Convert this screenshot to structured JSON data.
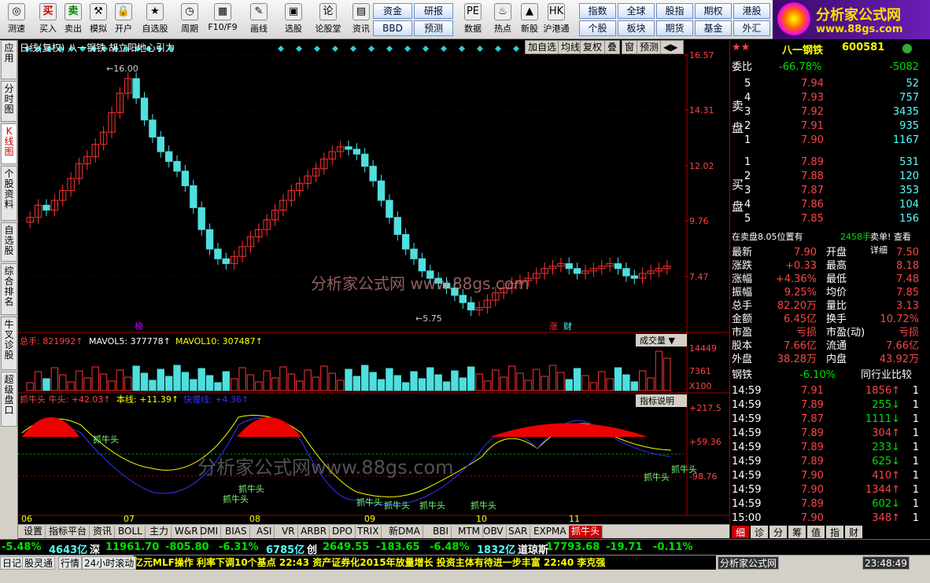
{
  "toolbar": {
    "buttons": [
      "测速",
      "买入",
      "卖出",
      "模拟",
      "开户",
      "自选股",
      "周期",
      "F10/F9",
      "画线",
      "选股",
      "论股堂",
      "资讯",
      "数据",
      "热点",
      "新股",
      "沪港通"
    ],
    "grid1": [
      "资金",
      "研报",
      "BBD",
      "预测"
    ],
    "grid2": [
      "指数",
      "全球",
      "股指",
      "期权",
      "港股",
      "个股",
      "板块",
      "期货",
      "基金",
      "外汇"
    ]
  },
  "logo": {
    "name": "分析家公式网",
    "url": "www.88gs.com"
  },
  "left_tabs": [
    "应用",
    "分时图",
    "K线图",
    "个股资料",
    "自选股",
    "综合排名",
    "牛叉诊股",
    "超级盘口"
  ],
  "chart": {
    "header": "日线(复权) 八一钢铁 胡立阳地心引力",
    "top_buttons": [
      "加自选",
      "均线",
      "复权",
      "叠",
      "窗",
      "预测"
    ],
    "price_ticks": [
      "16.57",
      "14.31",
      "12.02",
      "9.76",
      "7.47"
    ],
    "hi_label": "16.00",
    "lo_label": "5.75",
    "watermark1": "分析家公式网 www.88gs.com",
    "watermark2": "分析家公式网www.88gs.com",
    "markers": [
      "榜",
      "涨",
      "财"
    ],
    "vol_header": {
      "total": "总手: 821992↑",
      "ma5": "MAVOL5: 377778↑",
      "ma10": "MAVOL10: 307487↑",
      "dropdown": "成交量"
    },
    "vol_ticks": [
      "14449",
      "7361",
      "X100"
    ],
    "ind_header": {
      "a": "抓牛头 牛头: +42.03↑",
      "b": "本线: +11.39↑",
      "c": "快慢线: +4.36↑",
      "btn": "指标说明"
    },
    "ind_ticks": [
      "+217.5",
      "+59.36",
      "-98.76"
    ],
    "ind_label": "抓牛头",
    "months": [
      "06",
      "07",
      "08",
      "09",
      "10",
      "11"
    ]
  },
  "quote": {
    "name": "八一钢铁",
    "code": "600581",
    "webi": "委比",
    "webi_pct": "-66.78%",
    "webi_diff": "-5082",
    "sell": [
      [
        "5",
        "7.94",
        "52"
      ],
      [
        "4",
        "7.93",
        "757"
      ],
      [
        "3",
        "7.92",
        "3435"
      ],
      [
        "2",
        "7.91",
        "935"
      ],
      [
        "1",
        "7.90",
        "1167"
      ]
    ],
    "buy": [
      [
        "1",
        "7.89",
        "531"
      ],
      [
        "2",
        "7.88",
        "120"
      ],
      [
        "3",
        "7.87",
        "353"
      ],
      [
        "4",
        "7.86",
        "104"
      ],
      [
        "5",
        "7.85",
        "156"
      ]
    ],
    "sell_label": "卖盘",
    "buy_label": "买盘",
    "notice": "在卖盘8.05位置有",
    "notice_vol": "2458手",
    "notice_tail": "卖单! 查看详细",
    "stats": [
      [
        "最新",
        "7.90",
        "开盘",
        "7.50"
      ],
      [
        "涨跌",
        "+0.33",
        "最高",
        "8.18"
      ],
      [
        "涨幅",
        "+4.36%",
        "最低",
        "7.48"
      ],
      [
        "振幅",
        "9.25%",
        "均价",
        "7.85"
      ],
      [
        "总手",
        "82.20万",
        "量比",
        "3.13"
      ],
      [
        "金额",
        "6.45亿",
        "换手",
        "10.72%"
      ],
      [
        "市盈",
        "亏损",
        "市盈(动)",
        "亏损"
      ],
      [
        "股本",
        "7.66亿",
        "流通",
        "7.66亿"
      ],
      [
        "外盘",
        "38.28万",
        "内盘",
        "43.92万"
      ]
    ],
    "industry": "钢铁",
    "industry_pct": "-6.10%",
    "industry_btn": "同行业比较",
    "ticks": [
      [
        "14:59",
        "7.91",
        "1856",
        "up"
      ],
      [
        "14:59",
        "7.89",
        "255",
        "dn"
      ],
      [
        "14:59",
        "7.87",
        "1111",
        "dn"
      ],
      [
        "14:59",
        "7.89",
        "304",
        "up"
      ],
      [
        "14:59",
        "7.89",
        "233",
        "dn"
      ],
      [
        "14:59",
        "7.89",
        "625",
        "dn"
      ],
      [
        "14:59",
        "7.90",
        "410",
        "up"
      ],
      [
        "14:59",
        "7.90",
        "1344",
        "up"
      ],
      [
        "14:59",
        "7.89",
        "602",
        "dn"
      ],
      [
        "15:00",
        "7.90",
        "348",
        "up"
      ]
    ],
    "tabs": [
      "细",
      "诊",
      "分",
      "筹",
      "值",
      "指",
      "财"
    ]
  },
  "bottom_tabs": [
    "设置",
    "指标平台",
    "资讯",
    "BOLL",
    "主力",
    "W&R",
    "DMI",
    "BIAS",
    "ASI",
    "VR",
    "ARBR",
    "DPO",
    "TRIX",
    "新DMA",
    "BBI",
    "MTM",
    "OBV",
    "SAR",
    "EXPMA",
    "抓牛头"
  ],
  "ticker": [
    "-5.48%",
    "4643亿",
    "深",
    "11961.70",
    "-805.80",
    "-6.31%",
    "6785亿",
    "创",
    "2649.55",
    "-183.65",
    "-6.48%",
    "1832亿",
    "道琼斯",
    "17793.68",
    "-19.71",
    "-0.11%"
  ],
  "status": {
    "left": [
      "日记",
      "股灵通",
      "行情",
      "24小时滚动"
    ],
    "news": "亿元MLF操作 利率下调10个基点     22:43 资产证券化2015年放量增长 投资主体有待进一步丰富     22:40 李克强",
    "right": "分析家公式网",
    "time": "23:48:49"
  }
}
